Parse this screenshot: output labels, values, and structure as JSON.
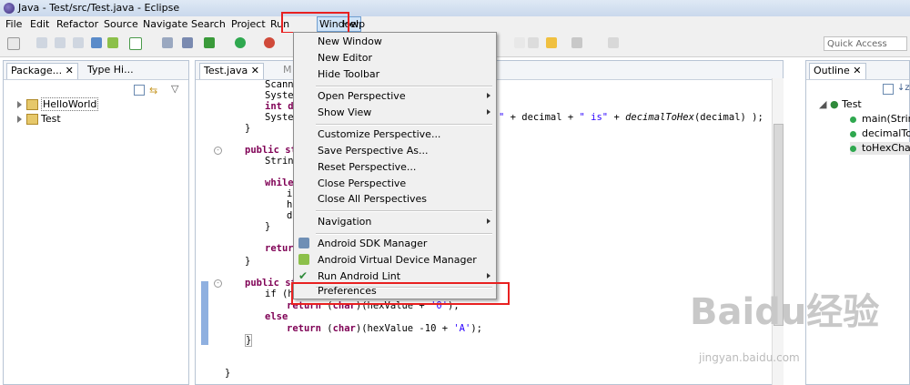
{
  "window": {
    "title": "Java - Test/src/Test.java - Eclipse"
  },
  "menubar": [
    "File",
    "Edit",
    "Refactor",
    "Source",
    "Navigate",
    "Search",
    "Project",
    "Run",
    "Window",
    "Help"
  ],
  "quick_access": {
    "placeholder": "Quick Access"
  },
  "package_explorer": {
    "tabs": [
      "Package...",
      "Type Hi..."
    ],
    "items": [
      "HelloWorld",
      "Test"
    ]
  },
  "editor": {
    "tabs": [
      "Test.java",
      "M"
    ],
    "code_lines": [
      "Scann",
      "Syste",
      "int d",
      "Syste",
      "}",
      "public st",
      "Strin",
      "while",
      "i",
      "h",
      "d",
      "}",
      "retur",
      "}",
      "public st",
      "if (h",
      "return (char)(hexValue + '0');",
      "else",
      "return (char)(hexValue -10 + 'A');",
      "}",
      "}"
    ],
    "line3_tail": "\" + decimal + \" is\" + decimalToHex(decimal) );"
  },
  "window_menu": {
    "items": [
      {
        "label": "New Window"
      },
      {
        "label": "New Editor"
      },
      {
        "label": "Hide Toolbar"
      },
      {
        "label": "Open Perspective",
        "submenu": true
      },
      {
        "label": "Show View",
        "submenu": true
      },
      {
        "label": "Customize Perspective..."
      },
      {
        "label": "Save Perspective As..."
      },
      {
        "label": "Reset Perspective..."
      },
      {
        "label": "Close Perspective"
      },
      {
        "label": "Close All Perspectives"
      },
      {
        "label": "Navigation",
        "submenu": true
      },
      {
        "label": "Android SDK Manager",
        "icon": "android-sdk-icon"
      },
      {
        "label": "Android Virtual Device Manager",
        "icon": "android-avd-icon"
      },
      {
        "label": "Run Android Lint",
        "icon": "checkmark-icon",
        "submenu": true
      },
      {
        "label": "Preferences"
      }
    ]
  },
  "outline": {
    "tab": "Outline",
    "root": "Test",
    "items": [
      "main(Strin",
      "decimalTo",
      "toHexCha"
    ]
  },
  "watermark": {
    "logo": "Baidu经验",
    "url": "jingyan.baidu.com"
  },
  "colors": {
    "highlight": "#e82020",
    "keyword": "#7f0055",
    "string": "#2a00ff"
  }
}
